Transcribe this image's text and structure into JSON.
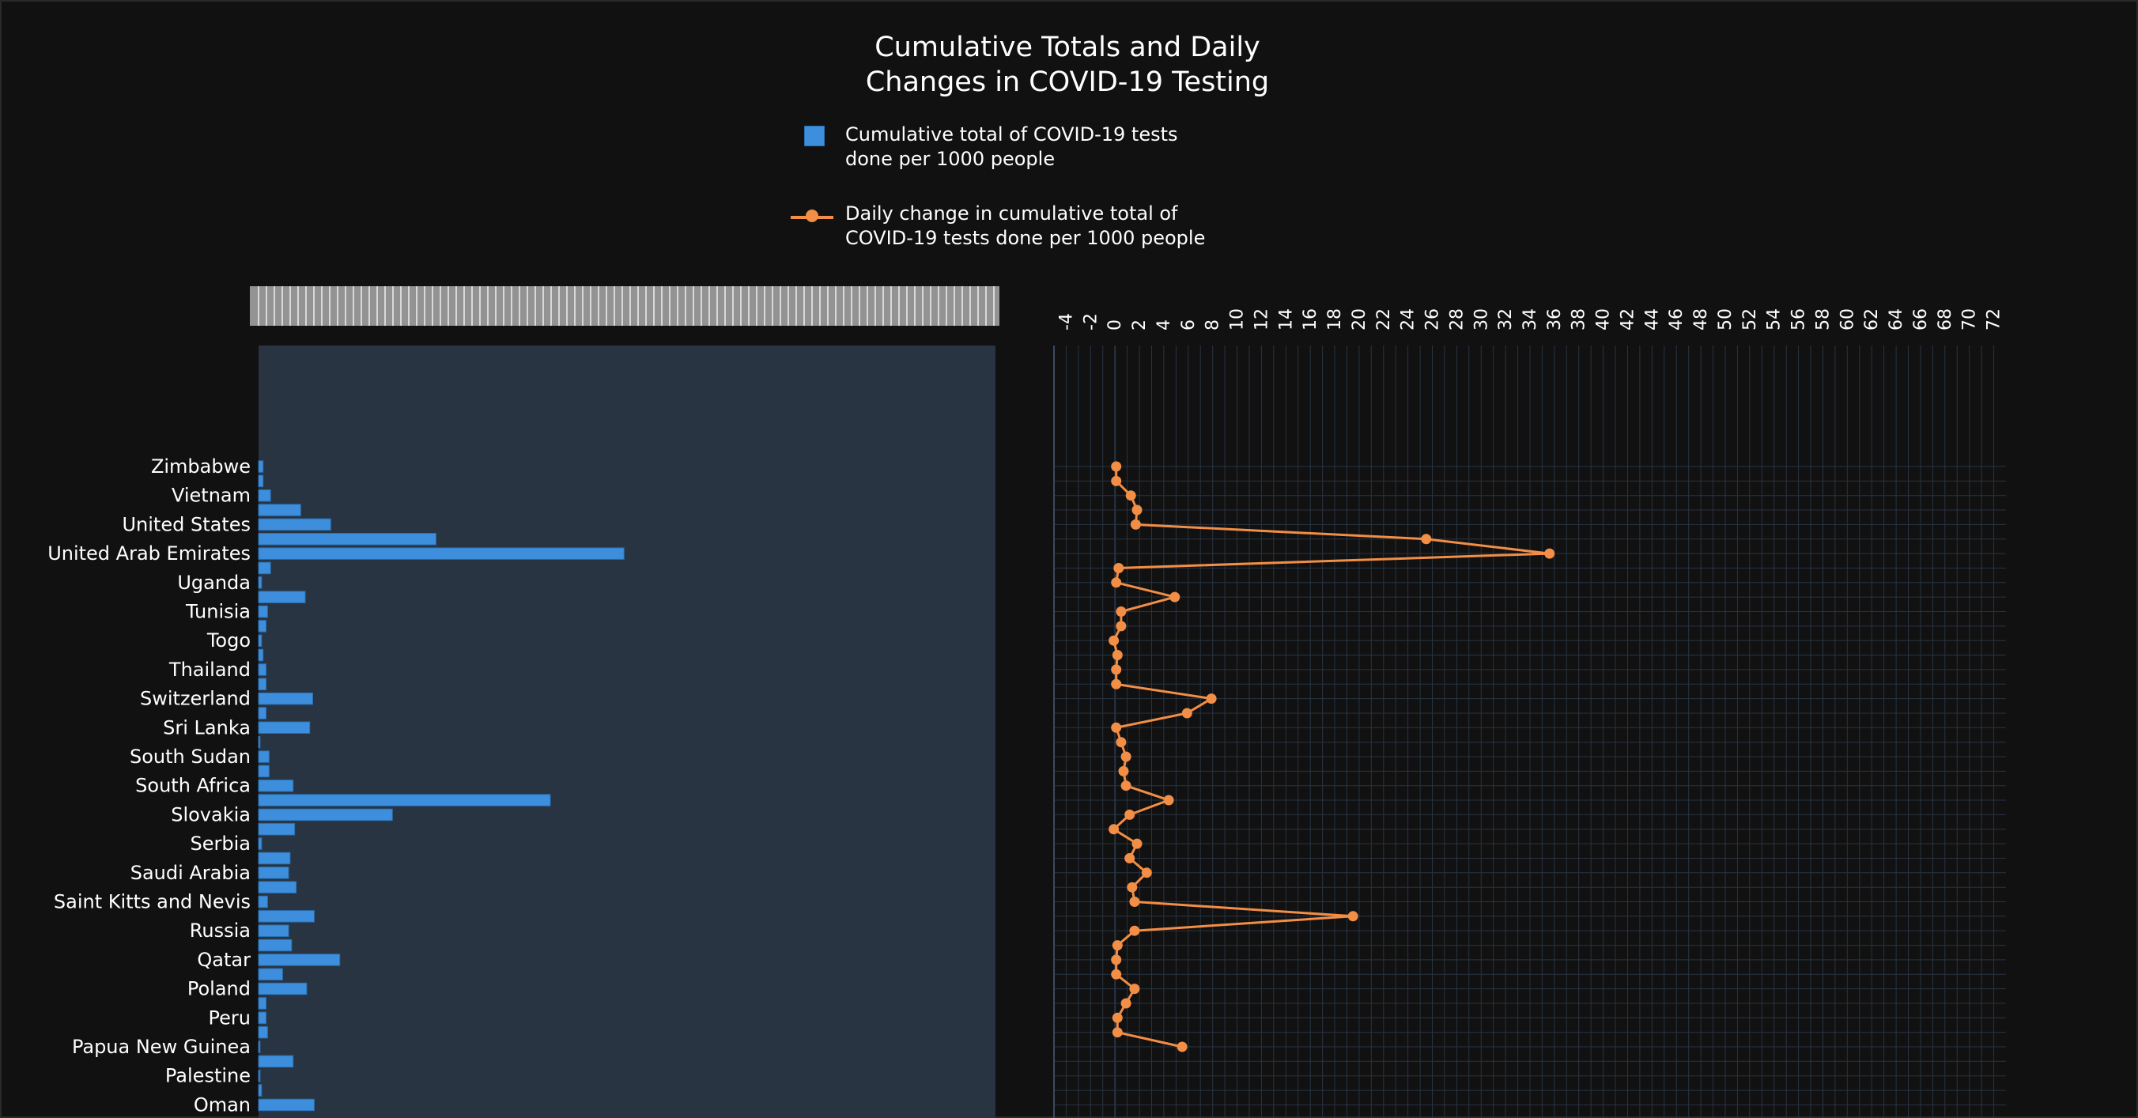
{
  "page": {
    "title_line1": "Cumulative Totals and Daily",
    "title_line2": "Changes in COVID-19 Testing",
    "legend": {
      "bar_line1": "Cumulative total of COVID-19 tests",
      "bar_line2": "done per 1000 people",
      "line_line1": "Daily change in cumulative total of",
      "line_line2": "COVID-19 tests done per 1000 people"
    }
  },
  "colors": {
    "background": "#111111",
    "bar_plot_bg": "#283442",
    "bar": "#3d8fdd",
    "bar_edge": "#2a6fb0",
    "line": "#f28e45",
    "grid": "#283442"
  },
  "chart_data": [
    {
      "type": "bar",
      "orientation": "horizontal",
      "series": [
        {
          "name": "Cumulative total of COVID-19 tests done per 1000 people"
        }
      ],
      "categories": [
        "Zimbabwe",
        "",
        "Vietnam",
        "",
        "United States",
        "",
        "United Arab Emirates",
        "",
        "Uganda",
        "",
        "Tunisia",
        "",
        "Togo",
        "",
        "Thailand",
        "",
        "Switzerland",
        "",
        "Sri Lanka",
        "",
        "South Sudan",
        "",
        "South Africa",
        "",
        "Slovakia",
        "",
        "Serbia",
        "",
        "Saudi Arabia",
        "",
        "Saint Kitts and Nevis",
        "",
        "Russia",
        "",
        "Qatar",
        "",
        "Poland",
        "",
        "Peru",
        "",
        "Papua New Guinea",
        "",
        "Palestine",
        "",
        "Oman",
        ""
      ],
      "values": [
        3,
        3,
        8,
        28,
        48,
        118,
        243,
        8,
        2,
        31,
        6,
        5,
        2,
        3,
        5,
        5,
        36,
        5,
        34,
        1,
        7,
        7,
        23,
        194,
        89,
        24,
        2,
        21,
        20,
        25,
        6,
        37,
        20,
        22,
        54,
        16,
        32,
        5,
        5,
        6,
        1,
        23,
        1,
        2,
        37
      ],
      "tick_labels": [
        "Zimbabwe",
        "Vietnam",
        "United States",
        "United Arab Emirates",
        "Uganda",
        "Tunisia",
        "Togo",
        "Thailand",
        "Switzerland",
        "Sri Lanka",
        "South Sudan",
        "South Africa",
        "Slovakia",
        "Serbia",
        "Saudi Arabia",
        "Saint Kitts and Nevis",
        "Russia",
        "Qatar",
        "Poland",
        "Peru",
        "Papua New Guinea",
        "Palestine",
        "Oman"
      ],
      "xlim": [
        0,
        490
      ]
    },
    {
      "type": "line",
      "series": [
        {
          "name": "Daily change in cumulative total of COVID-19 tests done per 1000 people",
          "values": [
            0.1,
            0.1,
            1.3,
            1.8,
            1.7,
            25.5,
            35.6,
            0.3,
            0.1,
            4.9,
            0.5,
            0.5,
            -0.1,
            0.2,
            0.1,
            0.1,
            7.9,
            5.9,
            0.1,
            0.5,
            0.9,
            0.7,
            0.9,
            4.4,
            1.2,
            -0.1,
            1.8,
            1.2,
            2.6,
            1.4,
            1.6,
            19.5,
            1.6,
            0.2,
            0.1,
            0.1,
            1.6,
            0.9,
            0.2,
            0.2,
            5.5
          ]
        }
      ],
      "x_tick_labels": [
        "-4",
        "-2",
        "0",
        "2",
        "4",
        "6",
        "8",
        "10",
        "12",
        "14",
        "16",
        "18",
        "20",
        "22",
        "24",
        "26",
        "28",
        "30",
        "32",
        "34",
        "36",
        "38",
        "40",
        "42",
        "44",
        "46",
        "48",
        "50",
        "52",
        "54",
        "56",
        "58",
        "60",
        "62",
        "64",
        "66",
        "68",
        "70",
        "72"
      ],
      "xlim": [
        -5,
        73
      ],
      "grid": true
    }
  ]
}
